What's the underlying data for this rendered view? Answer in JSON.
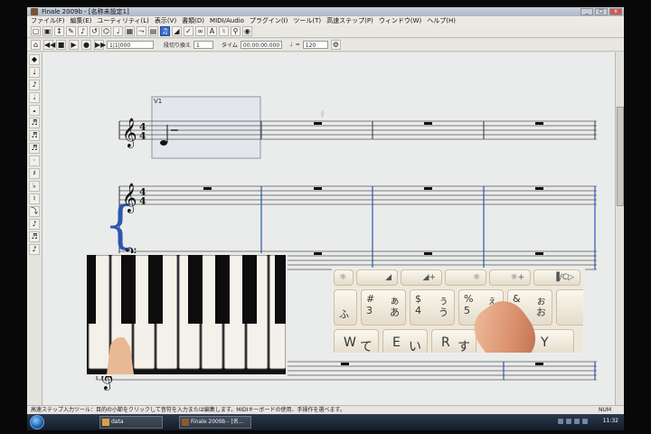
{
  "window": {
    "title": "Finale 2009b - [名称未設定1]",
    "controls": [
      "_",
      "□",
      "x"
    ]
  },
  "menubar": [
    "ファイル(F)",
    "編集(E)",
    "ユーティリティ(L)",
    "表示(V)",
    "書類(D)",
    "MIDI/Audio",
    "プラグイン(I)",
    "ツール(T)",
    "高速ステップ(P)",
    "ウィンドウ(W)",
    "ヘルプ(H)"
  ],
  "toolbar": {
    "tool_glyphs": [
      "▢",
      "▣",
      "↕",
      "✎",
      "♪",
      "↺",
      "⌬",
      "♩",
      "▦",
      "⤳",
      "▤",
      "♫",
      "◢",
      "✓",
      "∞",
      "A",
      "♮",
      "⚲",
      "◉"
    ],
    "active_index": 11
  },
  "transport": {
    "measure_value": "1|1|000",
    "label_bars": "段切り換え",
    "bars_value": "1",
    "label_time": "タイム",
    "time_value": "00:00:00.000",
    "tempo_value": "120"
  },
  "palette": [
    "◆",
    "♩",
    "♪",
    "𝅗𝅥",
    "𝅝",
    "♬",
    "♬",
    "♬",
    "·",
    "♯",
    "♭",
    "♮",
    "⤵",
    "♪",
    "♬",
    "♪"
  ],
  "score": {
    "voice_label": "V1",
    "time_signature": "4/4"
  },
  "status": {
    "text": "高速ステップ入力ツール：目的の小節をクリックして音符を入力または編集します。MIDIキーボードの使用、手操作を選べます。",
    "num": "NUM"
  },
  "taskbar": {
    "buttons": [
      "data",
      "Finale 2009b - [名..."
    ],
    "clock": "11:32"
  },
  "keyboard": {
    "row1": [
      "☼",
      "◢",
      "◢+",
      "☼",
      "☼+",
      "▐/C▷"
    ],
    "row2": [
      {
        "top": "#",
        "num": "3",
        "kana": "ぁ",
        "kana2": "あ"
      },
      {
        "top": "$",
        "num": "4",
        "kana": "ぅ",
        "kana2": "う"
      },
      {
        "top": "%",
        "num": "5",
        "kana": "ぇ",
        "kana2": "え"
      },
      {
        "top": "&",
        "num": "6",
        "kana": "ぉ",
        "kana2": "お"
      }
    ],
    "row3": [
      {
        "letter": "W",
        "kana": "て"
      },
      {
        "letter": "E",
        "kana": "い"
      },
      {
        "letter": "R",
        "kana": "す"
      },
      {
        "letter": "Y",
        "kana": ""
      }
    ]
  }
}
